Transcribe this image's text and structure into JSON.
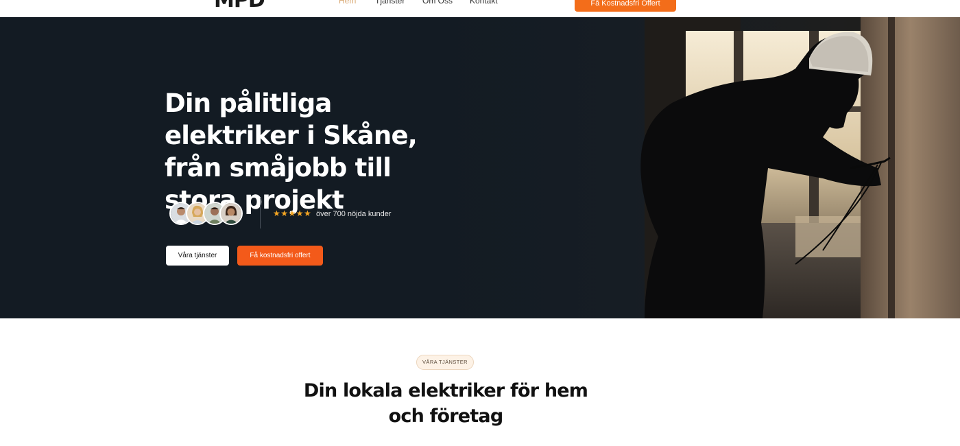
{
  "header": {
    "logo": "MPD",
    "nav": [
      {
        "label": "Hem",
        "active": true
      },
      {
        "label": "Tjänster",
        "active": false
      },
      {
        "label": "Om Oss",
        "active": false
      },
      {
        "label": "Kontakt",
        "active": false
      }
    ],
    "cta_label": "Få Kostnadsfri Offert"
  },
  "hero": {
    "title": "Din pålitliga elektriker i Skåne, från småjobb till stora projekt",
    "rating_stars": "★★★★★",
    "rating_value": 5,
    "reviews_text": "över 700 nöjda kunder",
    "avatar_count": 4,
    "primary_button": "Våra tjänster",
    "secondary_button": "Få kostnadsfri offert",
    "image_subject": "electrician-working-on-wall"
  },
  "services": {
    "eyebrow": "VÅRA TJÄNSTER",
    "title": "Din lokala elektriker för hem och företag"
  },
  "colors": {
    "accent_orange": "#f35a1a",
    "hero_bg": "#131b23",
    "nav_active": "#d9a873",
    "star": "#f5a623",
    "pill_bg": "#fdf2e6"
  },
  "icons": [
    "star-icon"
  ]
}
